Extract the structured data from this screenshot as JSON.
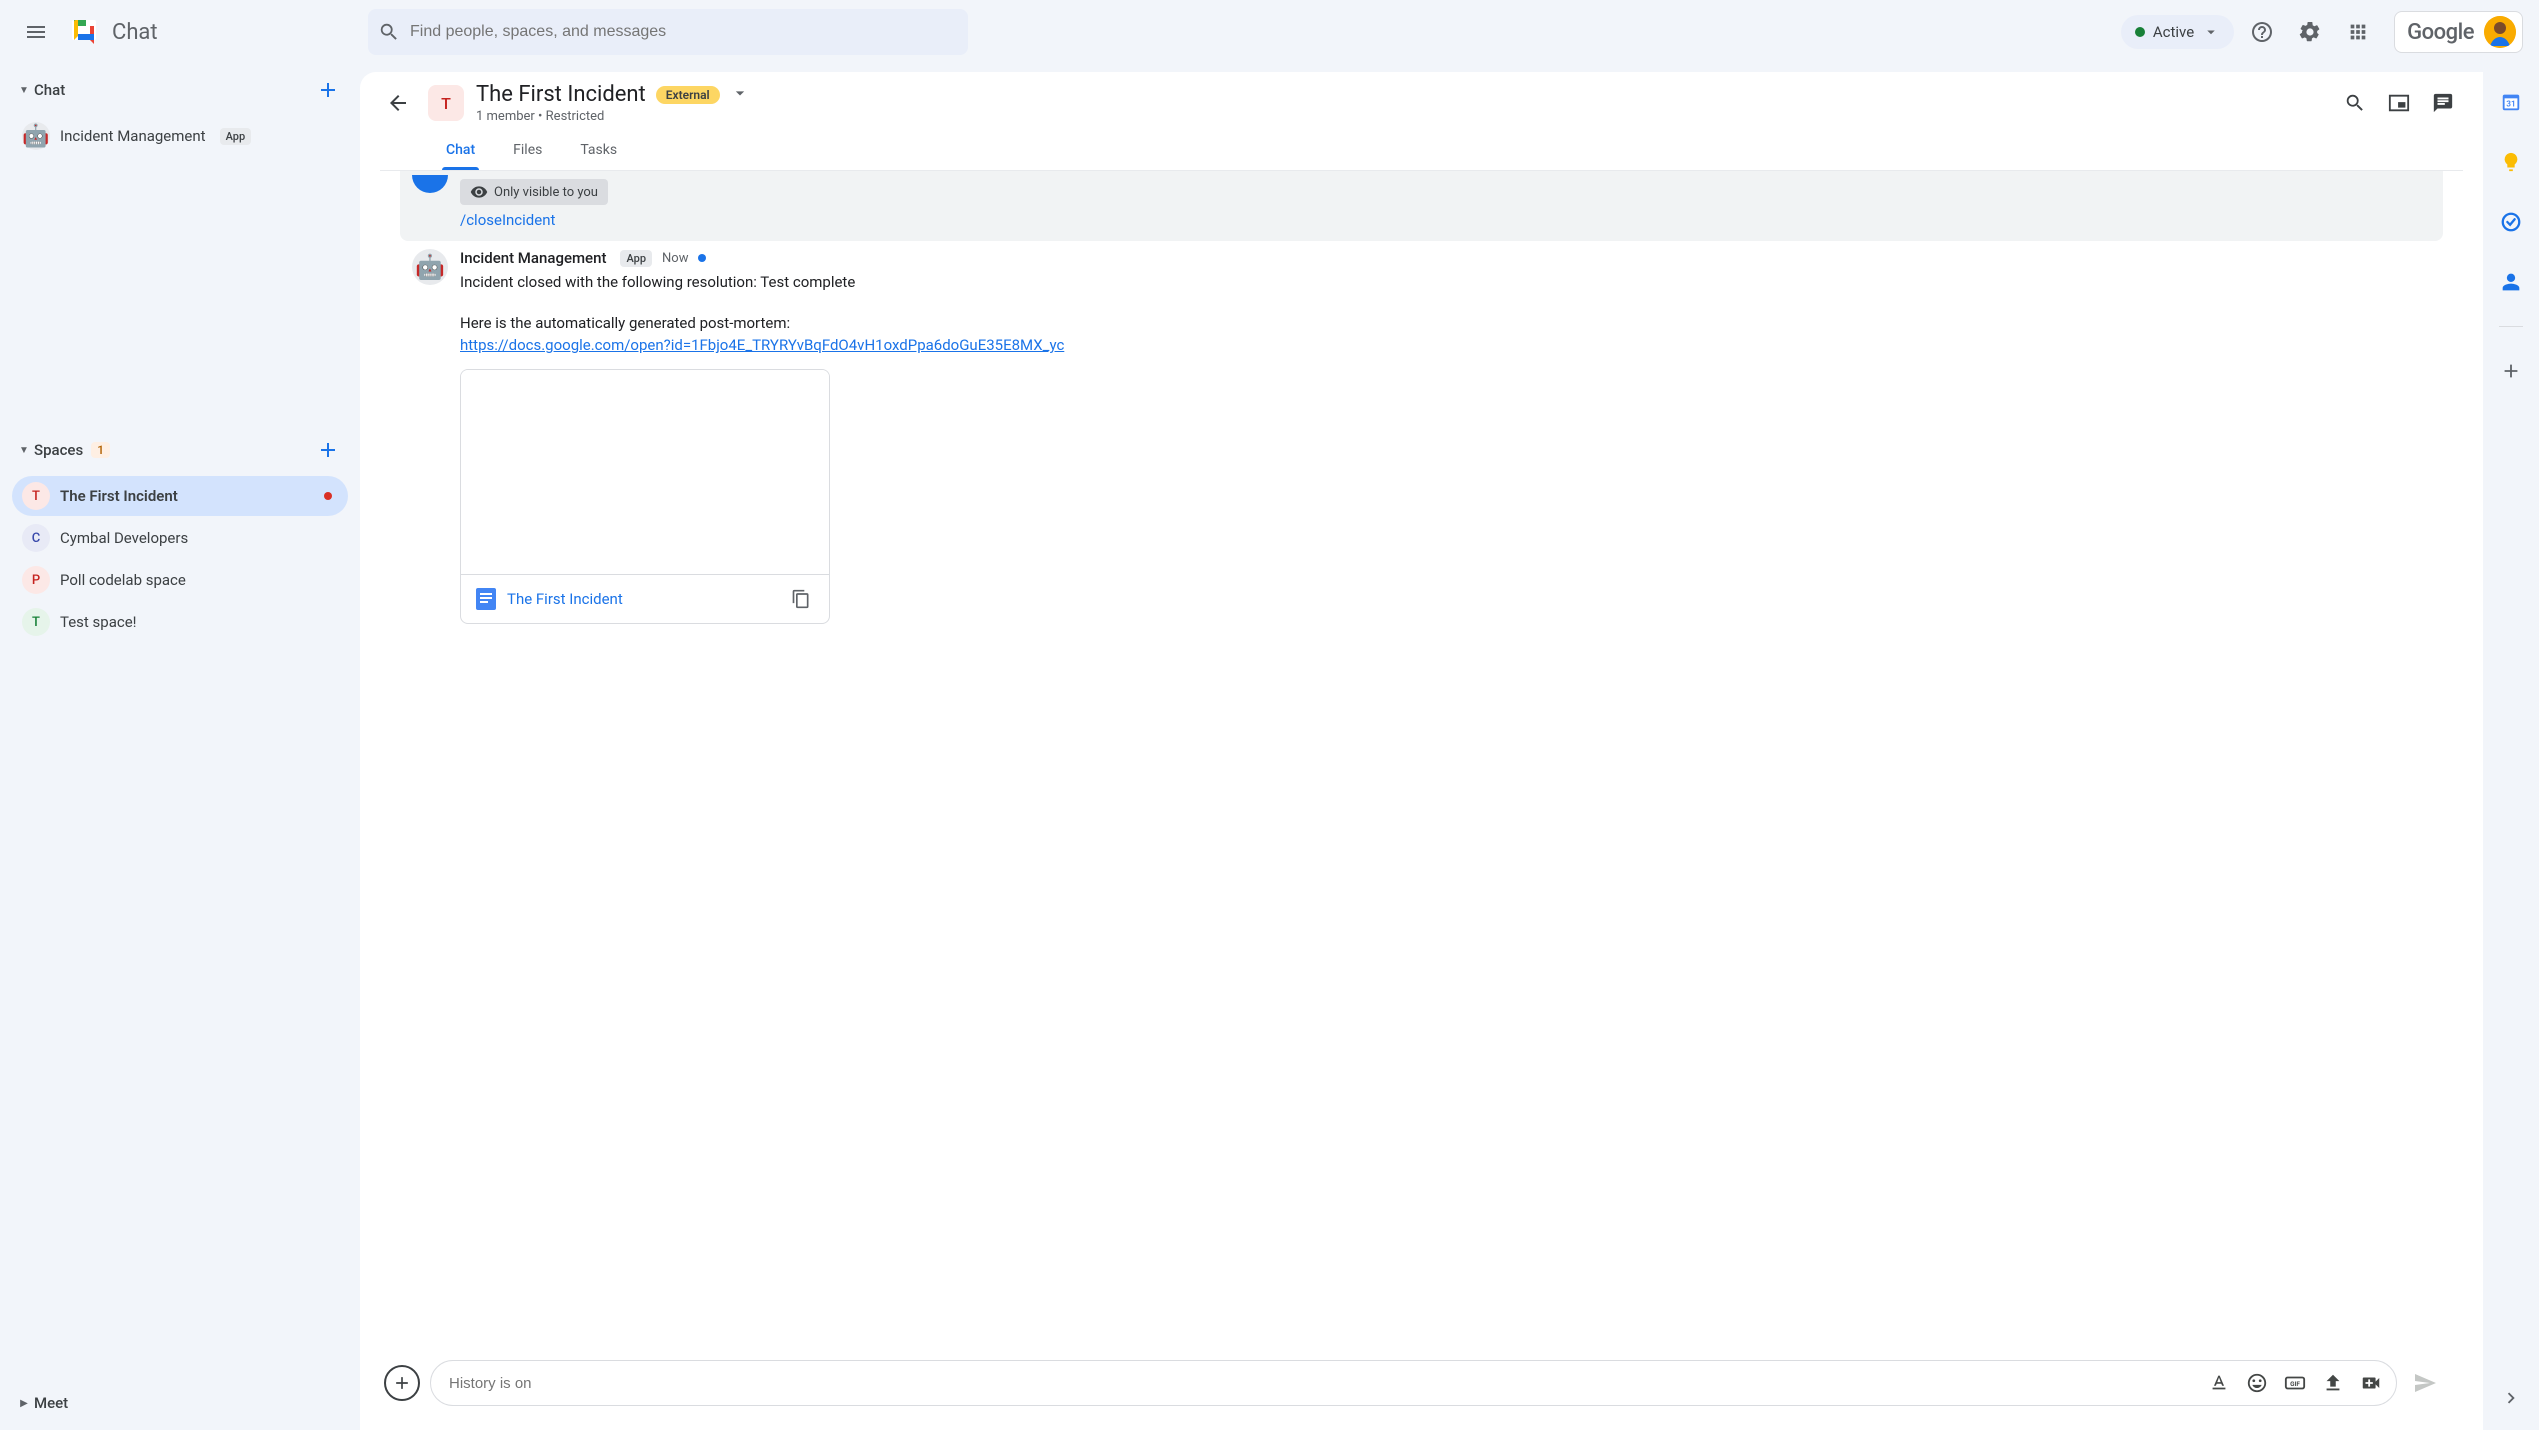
{
  "header": {
    "app_name": "Chat",
    "search_placeholder": "Find people, spaces, and messages",
    "status_text": "Active",
    "brand_text": "Google"
  },
  "sidebar": {
    "sections": {
      "chat": {
        "title": "Chat"
      },
      "spaces": {
        "title": "Spaces",
        "badge": "1"
      },
      "meet": {
        "title": "Meet"
      }
    },
    "chat_items": [
      {
        "label": "Incident Management",
        "chip": "App",
        "avatar_emoji": "🤖",
        "avatar_bg": "#e8eaed"
      }
    ],
    "space_items": [
      {
        "label": "The First Incident",
        "initial": "T",
        "bg": "#fce8e6",
        "fg": "#c5221f",
        "active": true,
        "bold": true,
        "dot": true
      },
      {
        "label": "Cymbal Developers",
        "initial": "C",
        "bg": "#e8eaf6",
        "fg": "#3949ab"
      },
      {
        "label": "Poll codelab space",
        "initial": "P",
        "bg": "#fce8e6",
        "fg": "#c5221f"
      },
      {
        "label": "Test space!",
        "initial": "T",
        "bg": "#e6f4ea",
        "fg": "#188038"
      }
    ]
  },
  "space": {
    "title": "The First Incident",
    "initial": "T",
    "badge": "External",
    "subtitle": "1 member  •  Restricted",
    "tabs": [
      "Chat",
      "Files",
      "Tasks"
    ],
    "active_tab": 0
  },
  "messages": {
    "private_label": "Only visible to you",
    "command": "/closeIncident",
    "bot": {
      "name": "Incident Management",
      "chip": "App",
      "time": "Now",
      "line1": "Incident closed with the following resolution: Test complete",
      "line2": "Here is the automatically generated post-mortem:",
      "link": "https://docs.google.com/open?id=1Fbjo4E_TRYRYvBqFdO4vH1oxdPpa6doGuE35E8MX_yc"
    },
    "doc_title": "The First Incident"
  },
  "composer": {
    "placeholder": "History is on"
  }
}
